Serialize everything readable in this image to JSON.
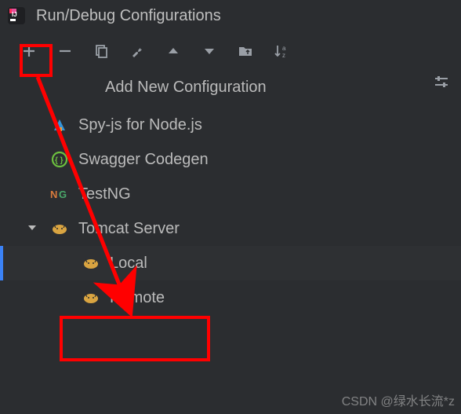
{
  "window": {
    "title": "Run/Debug Configurations"
  },
  "section": {
    "header": "Add New Configuration"
  },
  "items": {
    "spyjs": {
      "label": "Spy-js for Node.js"
    },
    "swagger": {
      "label": "Swagger Codegen"
    },
    "testng": {
      "label": "TestNG"
    },
    "tomcat": {
      "label": "Tomcat Server"
    },
    "tomcat_local": {
      "label": "Local"
    },
    "tomcat_remote": {
      "label": "Remote"
    }
  },
  "watermark": "CSDN @绿水长流*z"
}
